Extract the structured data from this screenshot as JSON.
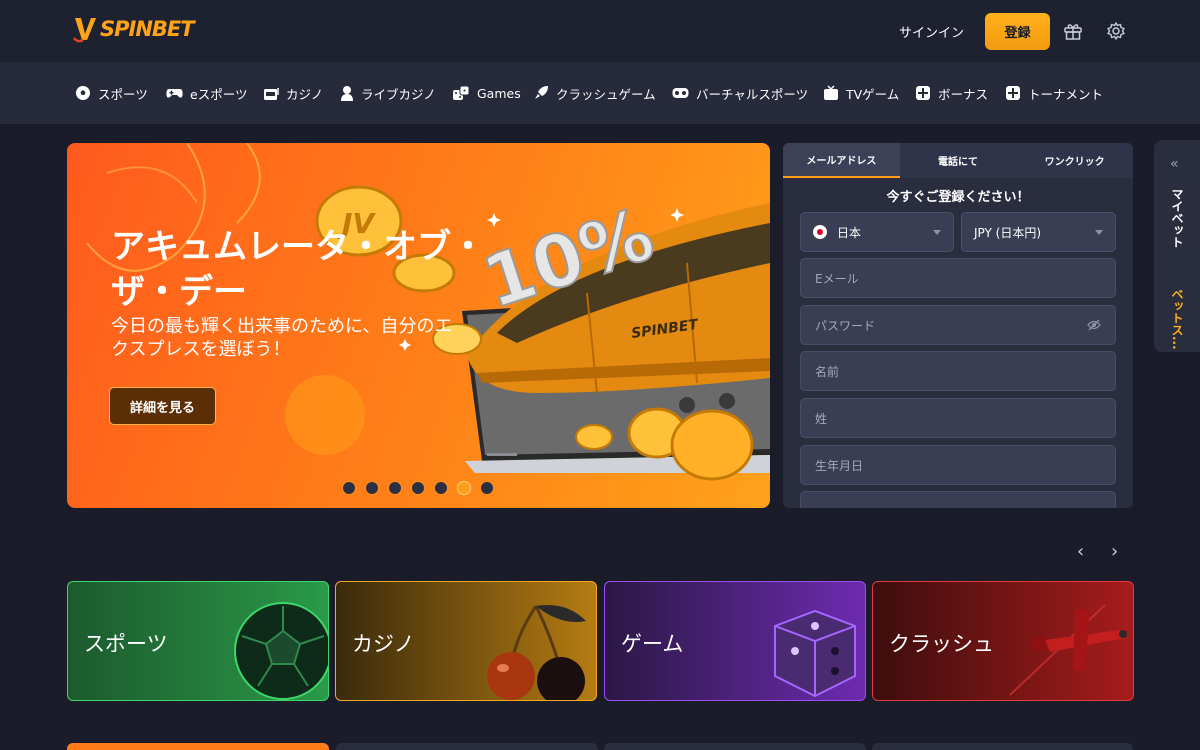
{
  "header": {
    "brand": "SPINBET",
    "signin_label": "サインイン",
    "register_label": "登録"
  },
  "nav": {
    "items": [
      {
        "label": "スポーツ",
        "icon": "soccer-ball-icon"
      },
      {
        "label": "eスポーツ",
        "icon": "gamepad-icon"
      },
      {
        "label": "カジノ",
        "icon": "slot-machine-icon"
      },
      {
        "label": "ライブカジノ",
        "icon": "dealer-icon"
      },
      {
        "label": "Games",
        "icon": "dice-icon"
      },
      {
        "label": "クラッシュゲーム",
        "icon": "rocket-icon"
      },
      {
        "label": "バーチャルスポーツ",
        "icon": "vr-headset-icon"
      },
      {
        "label": "TVゲーム",
        "icon": "tv-icon"
      },
      {
        "label": "ボーナス",
        "icon": "bonus-icon"
      },
      {
        "label": "トーナメント",
        "icon": "tournament-icon"
      }
    ]
  },
  "hero": {
    "title": "アキュムレータ・オブ・ザ・デー",
    "subtitle": "今日の最も輝く出来事のために、自分のエクスプレスを選ぼう！",
    "button_label": "詳細を見る",
    "badge": "10%",
    "train_logo": "SPINBET",
    "slide_count": 7,
    "active_slide": 6
  },
  "registration": {
    "tabs": [
      "メールアドレス",
      "電話にて",
      "ワンクリック"
    ],
    "active_tab": 0,
    "title": "今すぐご登録ください！",
    "country": "日本",
    "currency": "JPY (日本円)",
    "email_placeholder": "Eメール",
    "password_placeholder": "パスワード",
    "first_name_placeholder": "名前",
    "last_name_placeholder": "姓",
    "birthdate_placeholder": "生年月日"
  },
  "sidepanel": {
    "collapse": "«",
    "label_1": "マイベット",
    "label_2": "ベットス..."
  },
  "carousel": {
    "prev": "‹",
    "next": "›"
  },
  "categories": [
    {
      "label": "スポーツ"
    },
    {
      "label": "カジノ"
    },
    {
      "label": "ゲーム"
    },
    {
      "label": "クラッシュ"
    }
  ],
  "colors": {
    "accent": "#ffa319",
    "background": "#1a1d29",
    "panel": "#2a2d3e"
  }
}
